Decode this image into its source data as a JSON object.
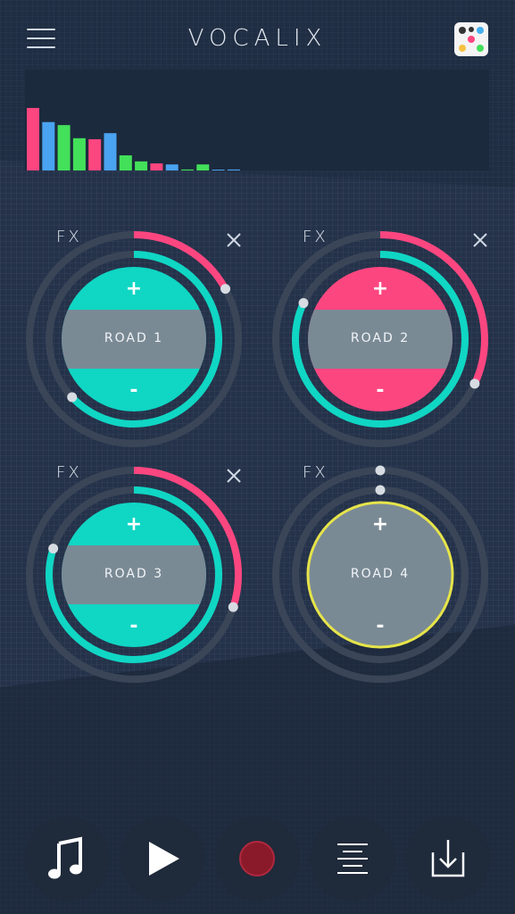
{
  "app": {
    "title": "VOCALIX"
  },
  "icons": {
    "menu": "hamburger-menu-icon",
    "dice": "dice-icon",
    "close": "close-icon",
    "music": "music-note-icon",
    "play": "play-icon",
    "record": "record-icon",
    "list": "align-center-list-icon",
    "download": "download-icon"
  },
  "colors": {
    "background": "#26344a",
    "teal": "#10d6c4",
    "pink": "#fc4680",
    "gray_pad": "#7a8a95",
    "ring": "#3a4658",
    "yellow": "#e6e44a",
    "record": "#8a1a2a"
  },
  "visualizer": {
    "bars": [
      {
        "level": 0.62,
        "color": "#fc4680"
      },
      {
        "level": 0.48,
        "color": "#4aa3f0"
      },
      {
        "level": 0.45,
        "color": "#43e05a"
      },
      {
        "level": 0.32,
        "color": "#43e05a"
      },
      {
        "level": 0.31,
        "color": "#fc4680"
      },
      {
        "level": 0.37,
        "color": "#4aa3f0"
      },
      {
        "level": 0.15,
        "color": "#43e05a"
      },
      {
        "level": 0.09,
        "color": "#43e05a"
      },
      {
        "level": 0.07,
        "color": "#fc4680"
      },
      {
        "level": 0.06,
        "color": "#4aa3f0"
      },
      {
        "level": 0.01,
        "color": "#43e05a"
      },
      {
        "level": 0.06,
        "color": "#43e05a"
      },
      {
        "level": 0.0,
        "color": "#4aa3f0"
      },
      {
        "level": 0.01,
        "color": "#4aa3f0"
      }
    ]
  },
  "pads": [
    {
      "id": "road1",
      "fx": "FX",
      "name": "ROAD 1",
      "plus": "+",
      "minus": "-",
      "fill": "#10d6c4",
      "active": true,
      "volume": 0.63,
      "fx_level": 0.17,
      "close": "×"
    },
    {
      "id": "road2",
      "fx": "FX",
      "name": "ROAD 2",
      "plus": "+",
      "minus": "-",
      "fill": "#fc4680",
      "active": true,
      "volume": 0.82,
      "fx_level": 0.32,
      "close": "×"
    },
    {
      "id": "road3",
      "fx": "FX",
      "name": "ROAD 3",
      "plus": "+",
      "minus": "-",
      "fill": "#10d6c4",
      "active": true,
      "volume": 0.8,
      "fx_level": 0.3,
      "close": "×"
    },
    {
      "id": "road4",
      "fx": "FX",
      "name": "ROAD 4",
      "plus": "+",
      "minus": "-",
      "fill": "#7a8a95",
      "active": false,
      "volume": 0.0,
      "fx_level": 0.0,
      "close": ""
    }
  ]
}
